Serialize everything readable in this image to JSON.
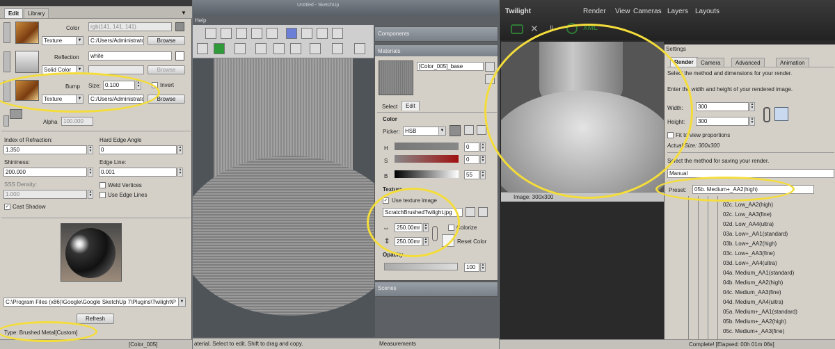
{
  "material_editor": {
    "title": "Material Editor",
    "tabs": [
      "Edit",
      "Library"
    ],
    "color_label": "Color",
    "color_value": "rgb(141, 141, 141)",
    "color_type": "Texture",
    "color_path": "C:/Users/Administrato",
    "browse": "Browse",
    "reflection_label": "Reflection",
    "reflection_value": "white",
    "reflection_type": "Solid Color",
    "bump_label": "Bump",
    "bump_size_label": "Size:",
    "bump_size": "0.100",
    "invert_label": "Invert",
    "bump_type": "Texture",
    "bump_path": "C:/Users/Administrato",
    "alpha_label": "Alpha",
    "alpha_value": "100.000",
    "ior_label": "Index of Refraction:",
    "ior_value": "1.350",
    "hard_edge_label": "Hard Edge Angle",
    "hard_edge_value": "0",
    "shininess_label": "Shininess:",
    "shininess_value": "200.000",
    "edge_line_label": "Edge Line:",
    "edge_line_value": "0.001",
    "sss_label": "SSS Density:",
    "sss_value": "1.000",
    "weld_label": "Weld Vertices",
    "use_edge_label": "Use Edge Lines",
    "cast_shadow_label": "Cast Shadow",
    "plugin_path": "C:\\Program Files (x86)\\Google\\Google SketchUp 7\\Plugins\\Twilight\\P",
    "refresh": "Refresh",
    "type_label": "Type: Brushed Metal[Custom]",
    "status_material": "[Color_005]"
  },
  "sketchup": {
    "title": "Untitled - SketchUp",
    "menu_help": "Help",
    "status_text": "aterial. Select to edit. Shift to drag and copy.",
    "measurements": "Measurements"
  },
  "components": {
    "title": "Components"
  },
  "materials": {
    "title": "Materials",
    "name": "[Color_005]_base",
    "tabs": [
      "Select",
      "Edit"
    ],
    "color_heading": "Color",
    "picker_label": "Picker:",
    "picker_value": "HSB",
    "h_label": "H",
    "h_value": "0",
    "s_label": "S",
    "s_value": "0",
    "b_label": "B",
    "b_value": "55",
    "texture_heading": "Texture",
    "use_texture": "Use texture image",
    "texture_file": "ScratchBrushedTwilight.jpg",
    "width": "250.00mr",
    "height": "250.00mr",
    "colorize": "Colorize",
    "reset_color": "Reset Color",
    "opacity_heading": "Opacity",
    "opacity_value": "100",
    "scenes_title": "Scenes"
  },
  "twilight": {
    "title": "Twilight",
    "menu": [
      "Render",
      "View",
      "Cameras",
      "Layers",
      "Layouts"
    ],
    "image_caption": "Image: 300x300",
    "settings_title": "Settings",
    "tabs": [
      "Render",
      "Camera",
      "Advanced",
      "Animation"
    ],
    "method_hint": "Select the method and dimensions for your render.",
    "size_hint": "Enter the width and height of your rendered image.",
    "width_label": "Width:",
    "width_value": "300",
    "height_label": "Height:",
    "height_value": "300",
    "fit_label": "Fit to view proportions",
    "actual_size": "Actual Size: 300x300",
    "save_hint": "Select the method for saving your render.",
    "save_method": "Manual",
    "preset_label": "Preset:",
    "preset_value": "05b. Medium+_AA2(high)",
    "presets": [
      "02c. Low_AA2(high)",
      "02c. Low_AA3(fine)",
      "02d. Low_AA4(ultra)",
      "03a. Low+_AA1(standard)",
      "03b. Low+_AA2(high)",
      "03c. Low+_AA3(fine)",
      "03d. Low+_AA4(ultra)",
      "04a. Medium_AA1(standard)",
      "04b. Medium_AA2(high)",
      "04c. Medium_AA3(fine)",
      "04d. Medium_AA4(ultra)",
      "05a. Medium+_AA1(standard)",
      "05b. Medium+_AA2(high)",
      "05c. Medium+_AA3(fine)"
    ],
    "status": "Complete! [Elapsed: 00h 01m 06s]"
  }
}
